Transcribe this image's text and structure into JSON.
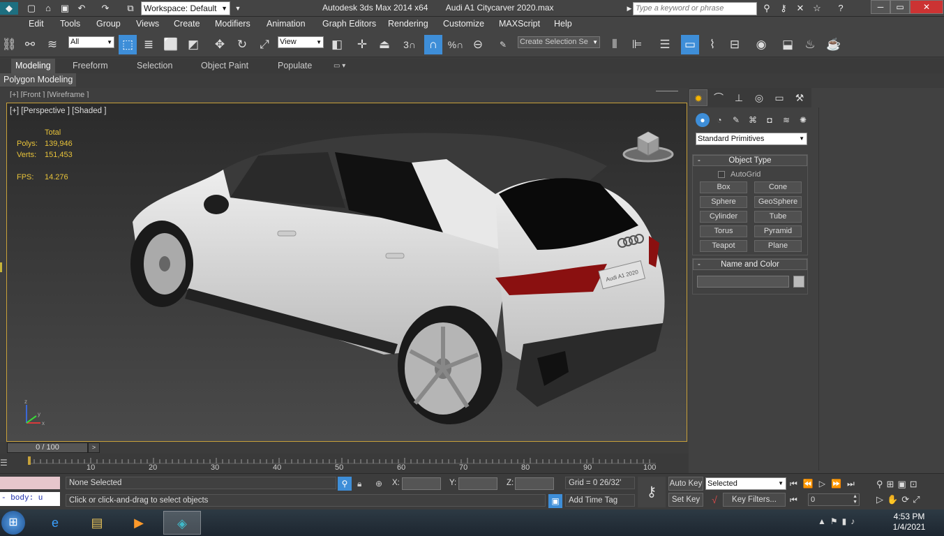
{
  "titlebar": {
    "workspace": "Workspace: Default",
    "app_title": "Autodesk 3ds Max  2014 x64",
    "file_title": "Audi A1 Citycarver 2020.max",
    "search_placeholder": "Type a keyword or phrase"
  },
  "menu": [
    "Edit",
    "Tools",
    "Group",
    "Views",
    "Create",
    "Modifiers",
    "Animation",
    "Graph Editors",
    "Rendering",
    "Customize",
    "MAXScript",
    "Help"
  ],
  "toolbar": {
    "filter": "All",
    "ref_coord": "View",
    "snap_label": "3",
    "selection_set_placeholder": "Create Selection Se"
  },
  "ribbon": {
    "tabs": [
      "Modeling",
      "Freeform",
      "Selection",
      "Object Paint",
      "Populate"
    ],
    "panel": "Polygon Modeling"
  },
  "viewport": {
    "back_label": "[+] [Front ] [Wireframe ]",
    "label": "[+] [Perspective ] [Shaded ]",
    "stats_header": "Total",
    "polys_label": "Polys:",
    "polys": "139,946",
    "verts_label": "Verts:",
    "verts": "151,453",
    "fps_label": "FPS:",
    "fps": "14.276",
    "plate_text": "Audi A1 2020",
    "axis": {
      "z": "z",
      "y": "y",
      "x": "x"
    }
  },
  "timeline": {
    "slider": "0 / 100",
    "next": ">",
    "ticks": [
      "10",
      "20",
      "30",
      "40",
      "50",
      "60",
      "70",
      "80",
      "90",
      "100"
    ]
  },
  "command_panel": {
    "category": "Standard Primitives",
    "object_type_title": "Object Type",
    "autogrid": "AutoGrid",
    "buttons": [
      "Box",
      "Cone",
      "Sphere",
      "GeoSphere",
      "Cylinder",
      "Tube",
      "Torus",
      "Pyramid",
      "Teapot",
      "Plane"
    ],
    "name_color_title": "Name and Color",
    "rollout_toggle": "-"
  },
  "status": {
    "maxscript": "body: u",
    "selection": "None Selected",
    "prompt": "Click or click-and-drag to select objects",
    "x_label": "X:",
    "y_label": "Y:",
    "z_label": "Z:",
    "grid": "Grid = 0 26/32'",
    "add_time_tag": "Add Time Tag",
    "auto_key": "Auto Key",
    "set_key": "Set Key",
    "key_mode": "Selected",
    "key_filters": "Key Filters...",
    "frame": "0"
  },
  "taskbar": {
    "time": "4:53 PM",
    "date": "1/4/2021"
  },
  "colors": {
    "accent": "#3e8ed8",
    "viewport_border": "#c9a13a",
    "stats": "#e8c33a"
  }
}
